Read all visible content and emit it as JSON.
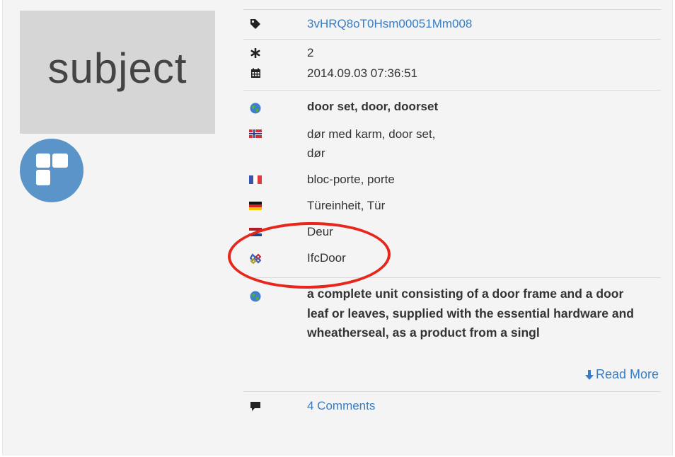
{
  "subject": {
    "title": "subject"
  },
  "meta": {
    "guid": "3vHRQ8oT0Hsm00051Mm008",
    "version": "2",
    "date": "2014.09.03 07:36:51"
  },
  "names": [
    {
      "lang_icon": "globe-icon",
      "text": "door set, door, doorset"
    },
    {
      "lang_icon": "flag-norway-icon",
      "text_line1": "dør med karm, door set,",
      "text_line2": "dør"
    },
    {
      "lang_icon": "flag-france-icon",
      "text": "bloc-porte, porte"
    },
    {
      "lang_icon": "flag-germany-icon",
      "text": "Türeinheit, Tür"
    },
    {
      "lang_icon": "flag-netherlands-icon",
      "text": "Deur"
    },
    {
      "lang_icon": "ifc-icon",
      "text": "IfcDoor"
    }
  ],
  "description": {
    "lang_icon": "globe-icon",
    "text": "a complete unit consisting of a door frame and a door leaf or leaves, supplied with the essential hardware and wheatherseal, as a product from a singl",
    "read_more_label": "Read More"
  },
  "comments": {
    "label": "4 Comments"
  },
  "colors": {
    "link": "#3a7cc2",
    "type_circle": "#5b94c8",
    "highlight_ellipse": "#e8261c",
    "subject_box": "#d6d6d6"
  }
}
